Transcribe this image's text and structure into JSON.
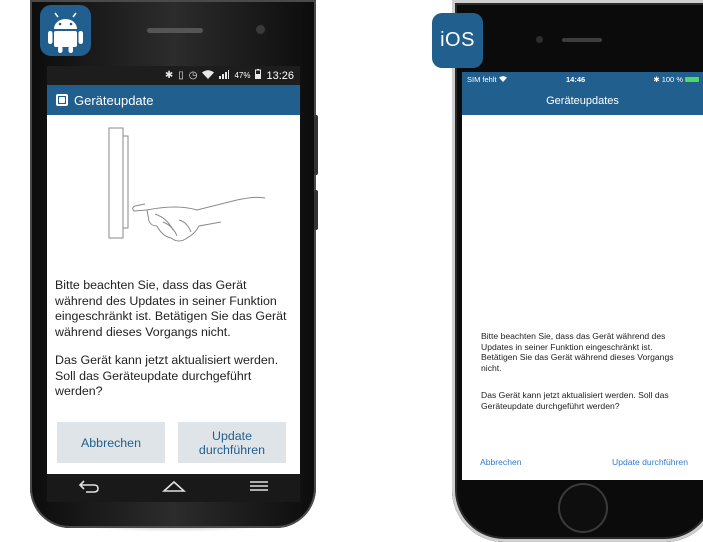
{
  "android": {
    "statusbar": {
      "battery": "47%",
      "time": "13:26"
    },
    "app_title": "Geräteupdate",
    "message": [
      "Bitte beachten Sie, dass das Gerät während des Updates in seiner Funktion eingeschränkt ist. Betätigen Sie das Gerät während dieses Vorgangs nicht.",
      "Das Gerät kann jetzt aktualisiert werden. Soll das Geräteupdate durchgeführt werden?"
    ],
    "cancel_label": "Abbrechen",
    "update_label": "Update durchführen",
    "icons": [
      "android-robot-icon",
      "back-icon",
      "home-icon",
      "menu-icon"
    ]
  },
  "ios": {
    "badge_label": "iOS",
    "statusbar": {
      "carrier": "SIM fehlt",
      "time": "14:46",
      "battery": "100 %"
    },
    "nav_title": "Geräteupdates",
    "message": [
      "Bitte beachten Sie, dass das Gerät während des Updates in seiner Funktion eingeschränkt ist. Betätigen Sie das Gerät während dieses Vorgangs nicht.",
      "Das Gerät kann jetzt aktualisiert werden. Soll das Geräteupdate durchgeführt werden?"
    ],
    "cancel_label": "Abbrechen",
    "update_label": "Update durchführen"
  },
  "colors": {
    "brand_blue": "#215f8e",
    "ios_link": "#2f7bd0",
    "button_bg": "#dfe4e9"
  }
}
